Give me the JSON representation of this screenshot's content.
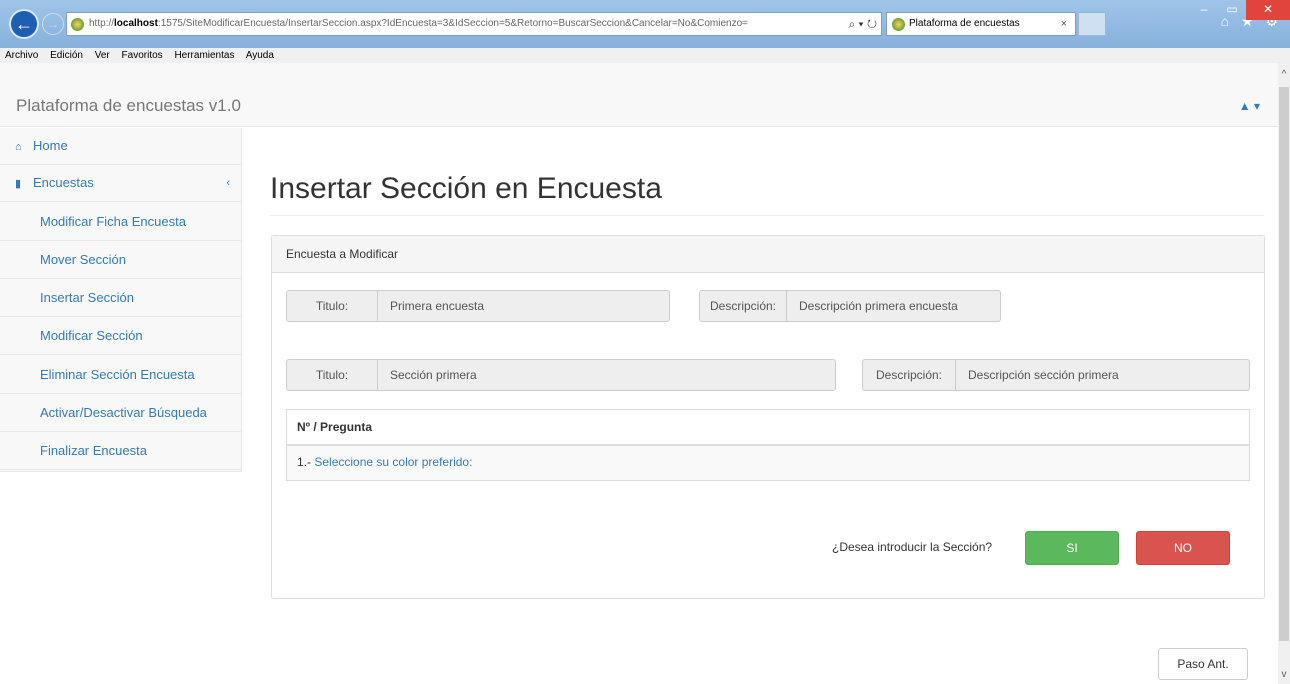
{
  "browser": {
    "url_prefix": "http://",
    "url_host": "localhost",
    "url_rest": ":1575/SiteModificarEncuesta/InsertarSeccion.aspx?IdEncuesta=3&IdSeccion=5&Retorno=BuscarSeccion&Cancelar=No&Comienzo=",
    "url_tools": "⌕ ▾ ↻",
    "tab_title": "Plataforma de encuestas",
    "tab_close": "×",
    "toolbar_icons": "⌂ ★ ⚙",
    "window_controls": {
      "minimize": "–",
      "maximize": "▭",
      "close": "✕"
    }
  },
  "menu": [
    "Archivo",
    "Edición",
    "Ver",
    "Favoritos",
    "Herramientas",
    "Ayuda"
  ],
  "app": {
    "brand": "Plataforma de encuestas v1.0",
    "user_menu": "▲ ▾"
  },
  "sidebar": {
    "home": "Home",
    "encuestas": "Encuestas",
    "caret": "‹",
    "items": [
      "Modificar Ficha Encuesta",
      "Mover Sección",
      "Insertar Sección",
      "Modificar Sección",
      "Eliminar Sección Encuesta",
      "Activar/Desactivar Búsqueda",
      "Finalizar Encuesta"
    ]
  },
  "main": {
    "title": "Insertar Sección en Encuesta",
    "panel_heading": "Encuesta a Modificar",
    "encuesta": {
      "titulo_label": "Titulo:",
      "titulo_value": "Primera encuesta",
      "descripcion_label": "Descripción:",
      "descripcion_value": "Descripción primera encuesta"
    },
    "seccion": {
      "titulo_label": "Titulo:",
      "titulo_value": "Sección primera",
      "descripcion_label": "Descripción:",
      "descripcion_value": "Descripción sección primera"
    },
    "table": {
      "header": "Nº / Pregunta",
      "rows": [
        {
          "num": "1.- ",
          "text": "Seleccione su color preferido:"
        }
      ]
    },
    "confirm_question": "¿Desea introducir la Sección?",
    "btn_si": "SI",
    "btn_no": "NO",
    "btn_prev": "Paso Ant."
  }
}
